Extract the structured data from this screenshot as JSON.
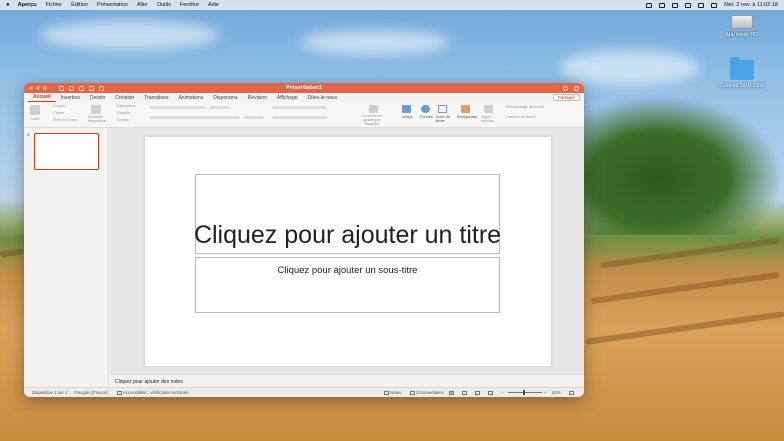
{
  "menubar": {
    "apple": "",
    "app_name": "Aperçu",
    "items": [
      "Fichier",
      "Édition",
      "Présentation",
      "Aller",
      "Outils",
      "Fenêtre",
      "Aide"
    ],
    "clock": "Mer. 2 nov. à 11:02:18"
  },
  "desktop": {
    "icons": [
      {
        "label": "Macintosh HD"
      },
      {
        "label": "Gothard 1910-1966"
      }
    ]
  },
  "window": {
    "title": "Présentation1",
    "tabs": [
      "Accueil",
      "Insertion",
      "Dessin",
      "Création",
      "Transitions",
      "Animations",
      "Diaporama",
      "Révision",
      "Affichage",
      "Dites-le-nous"
    ],
    "active_tab": "Accueil",
    "share_label": "Partager",
    "ribbon": {
      "coller": "Coller",
      "couper": "Couper",
      "copier": "Copier",
      "mise_en_forme": "Mise en forme",
      "nouvelle_diapo": "Nouvelle diapositive",
      "disposition": "Disposition",
      "retablir": "Rétablir",
      "section": "Section",
      "convertir": "Convertir en graphique SmartArt",
      "image": "Image",
      "formes": "Formes",
      "zone_texte": "Zone de texte",
      "reorganiser": "Réorganiser",
      "styles_rapides": "Styles rapides",
      "remplissage": "Remplissage de forme",
      "contour": "Contour de forme"
    },
    "thumbnail_number": "1",
    "slide": {
      "title_placeholder": "Cliquez pour ajouter un titre",
      "subtitle_placeholder": "Cliquez pour ajouter un sous-titre"
    },
    "notes_placeholder": "Cliquez pour ajouter des notes",
    "status": {
      "slide_info": "Diapositive 1 sur 1",
      "language": "Français (France)",
      "accessibility": "Accessibilité : vérification terminée",
      "notes": "Notes",
      "comments": "Commentaires",
      "zoom": "52%",
      "zoom_fraction": 0.52
    }
  }
}
